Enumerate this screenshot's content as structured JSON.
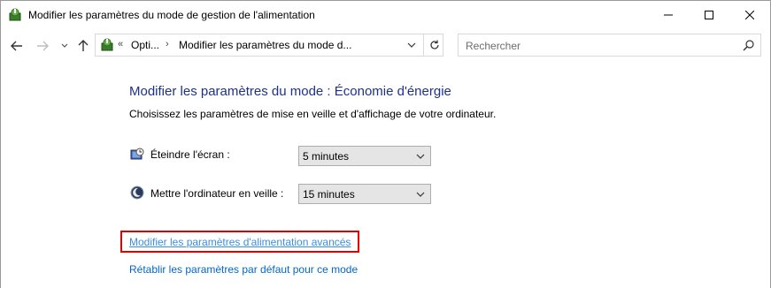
{
  "window": {
    "title": "Modifier les paramètres du mode de gestion de l'alimentation",
    "minimize_icon": "minimize-icon",
    "maximize_icon": "maximize-icon",
    "close_icon": "close-icon"
  },
  "navigation": {
    "back_icon": "arrow-left-icon",
    "forward_icon": "arrow-right-icon",
    "recent_icon": "chevron-down-icon",
    "up_icon": "arrow-up-icon"
  },
  "address_bar": {
    "overflow": "«",
    "breadcrumbs": [
      "Opti...",
      "Modifier les paramètres du mode d..."
    ],
    "separator": "›"
  },
  "search": {
    "placeholder": "Rechercher"
  },
  "main": {
    "heading": "Modifier les paramètres du mode : Économie d'énergie",
    "subtitle": "Choisissez les paramètres de mise en veille et d'affichage de votre ordinateur.",
    "settings": [
      {
        "label": "Éteindre l'écran :",
        "value": "5 minutes",
        "icon": "monitor-clock-icon"
      },
      {
        "label": "Mettre l'ordinateur en veille :",
        "value": "15 minutes",
        "icon": "moon-icon"
      }
    ],
    "links": {
      "advanced": "Modifier les paramètres d'alimentation avancés",
      "restore": "Rétablir les paramètres par défaut pour ce mode"
    }
  },
  "colors": {
    "heading": "#1e3287",
    "link": "#0066cc",
    "highlight": "#e00000"
  }
}
